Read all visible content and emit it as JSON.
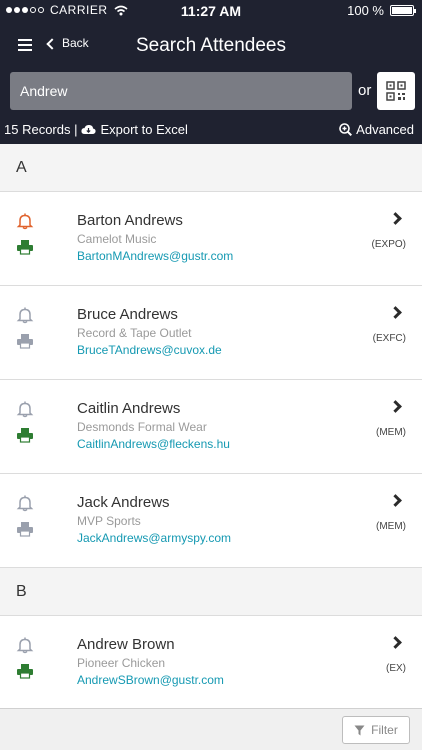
{
  "status": {
    "carrier": "CARRIER",
    "time": "11:27 AM",
    "battery": "100 %",
    "battery_level": 1.0
  },
  "header": {
    "back_label": "Back",
    "title": "Search Attendees"
  },
  "search": {
    "value": "Andrew",
    "or_label": "or"
  },
  "toolbar": {
    "records": "15 Records |",
    "export_label": "Export to Excel",
    "advanced_label": "Advanced"
  },
  "colors": {
    "header_bg": "#1f2230",
    "bell_active": "#e0632e",
    "printer_active": "#2e7d32",
    "icon_inactive": "#9aa0ad",
    "email": "#1599b2"
  },
  "sections": [
    {
      "letter": "A",
      "attendees": [
        {
          "name": "Barton Andrews",
          "company": "Camelot Music",
          "email": "BartonMAndrews@gustr.com",
          "type": "(EXPO)",
          "alert": true,
          "printed": true
        },
        {
          "name": "Bruce Andrews",
          "company": "Record & Tape Outlet",
          "email": "BruceTAndrews@cuvox.de",
          "type": "(EXFC)",
          "alert": false,
          "printed": false
        },
        {
          "name": "Caitlin Andrews",
          "company": "Desmonds Formal Wear",
          "email": "CaitlinAndrews@fleckens.hu",
          "type": "(MEM)",
          "alert": false,
          "printed": true
        },
        {
          "name": "Jack Andrews",
          "company": "MVP Sports",
          "email": "JackAndrews@armyspy.com",
          "type": "(MEM)",
          "alert": false,
          "printed": false
        }
      ]
    },
    {
      "letter": "B",
      "attendees": [
        {
          "name": "Andrew Brown",
          "company": "Pioneer Chicken",
          "email": "AndrewSBrown@gustr.com",
          "type": "(EX)",
          "alert": false,
          "printed": true
        }
      ]
    }
  ],
  "footer": {
    "filter_label": "Filter"
  }
}
